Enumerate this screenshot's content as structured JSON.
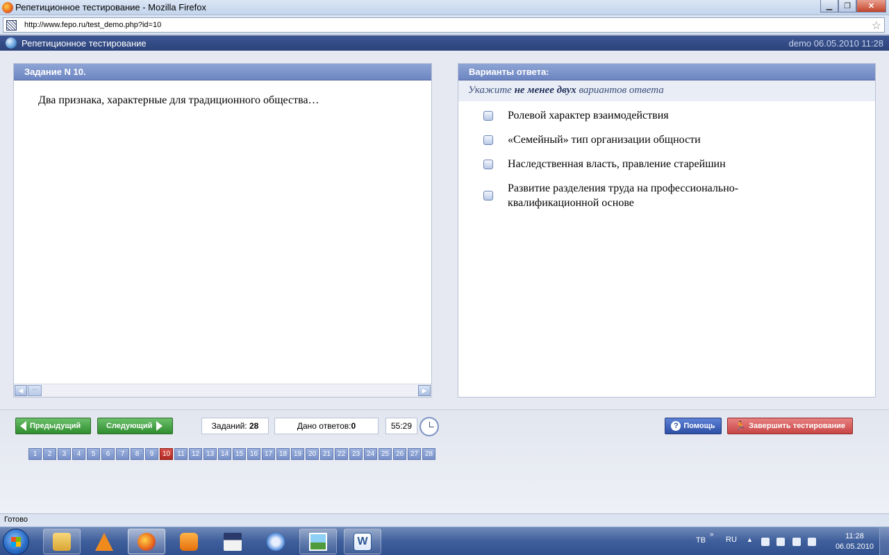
{
  "window": {
    "title": "Репетиционное тестирование - Mozilla Firefox",
    "url": "http://www.fepo.ru/test_demo.php?id=10"
  },
  "app": {
    "title": "Репетиционное тестирование",
    "user_date": "demo 06.05.2010 11:28"
  },
  "task": {
    "header": "Задание N 10.",
    "question": "Два признака, характерные для традиционного общества…"
  },
  "answers": {
    "header": "Варианты ответа:",
    "hint_prefix": "Укажите",
    "hint_bold": "не менее двух",
    "hint_suffix": "вариантов ответа",
    "options": [
      "Ролевой характер взаимодействия",
      "«Семейный» тип организации общности",
      "Наследственная власть, правление старейшин",
      "Развитие разделения труда на профессионально-квалификационной основе"
    ]
  },
  "nav": {
    "prev_label": "Предыдущий",
    "next_label": "Следующий",
    "tasks_label": "Заданий:",
    "tasks_count": "28",
    "answers_label": "Дано ответов:",
    "answers_count": "0",
    "timer": "55:29",
    "help_label": "Помощь",
    "finish_label": "Завершить тестирование",
    "pages": [
      "1",
      "2",
      "3",
      "4",
      "5",
      "6",
      "7",
      "8",
      "9",
      "10",
      "11",
      "12",
      "13",
      "14",
      "15",
      "16",
      "17",
      "18",
      "19",
      "20",
      "21",
      "22",
      "23",
      "24",
      "25",
      "26",
      "27",
      "28"
    ],
    "current_page": "10"
  },
  "status": {
    "text": "Готово"
  },
  "taskbar": {
    "lang1": "TB",
    "lang2": "RU",
    "time": "11:28",
    "date": "06.05.2010",
    "items": [
      "explorer-icon",
      "vlc-icon",
      "firefox-icon",
      "media-player-icon",
      "floppy-icon",
      "itunes-icon",
      "picture-viewer-icon",
      "word-icon"
    ]
  }
}
